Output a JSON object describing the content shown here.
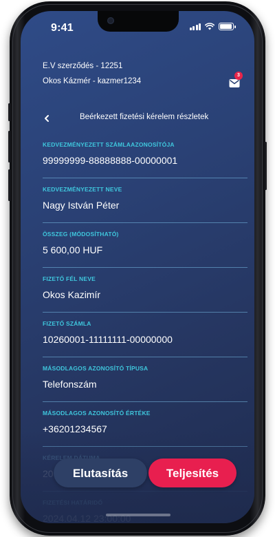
{
  "status_bar": {
    "time": "9:41",
    "icons": [
      "signal-icon",
      "wifi-icon",
      "battery-icon"
    ]
  },
  "account": {
    "contract": "E.V szerződés - 12251",
    "user": "Okos Kázmér - kazmer1234"
  },
  "notifications": {
    "icon": "mail-icon",
    "count": "3"
  },
  "page": {
    "back_icon": "chevron-left-icon",
    "title": "Beérkezett fizetési kérelem részletek"
  },
  "fields": [
    {
      "label": "Kedvezményezett számlaazonosítója",
      "value": "99999999-88888888-00000001"
    },
    {
      "label": "Kedvezményezett neve",
      "value": "Nagy István Péter"
    },
    {
      "label": "Összeg (módosítható)",
      "value": "5 600,00 HUF"
    },
    {
      "label": "Fizető fél neve",
      "value": "Okos Kazimír"
    },
    {
      "label": "Fizető számla",
      "value": "10260001-11111111-00000000"
    },
    {
      "label": "Másodlagos azonosító típusa",
      "value": "Telefonszám"
    },
    {
      "label": "Másodlagos azonosító értéke",
      "value": "+36201234567"
    },
    {
      "label": "Kérelem dátuma",
      "value": "20"
    },
    {
      "label": "Fizetési határidő",
      "value": "2024.04.12 23:00:00"
    }
  ],
  "actions": {
    "reject": "Elutasítás",
    "accept": "Teljesítés"
  },
  "colors": {
    "accent": "#3fc7dd",
    "primary": "#e81f4f",
    "background": "#2a4175"
  }
}
